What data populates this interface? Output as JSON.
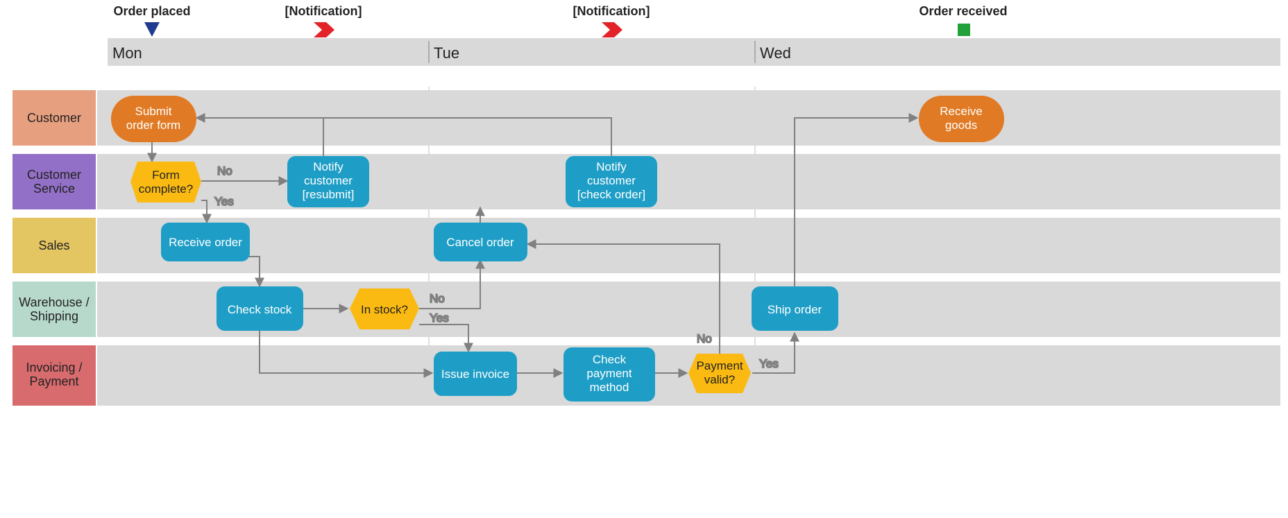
{
  "timeline": {
    "days": [
      "Mon",
      "Tue",
      "Wed"
    ],
    "markers": {
      "order_placed": {
        "label": "Order placed"
      },
      "notification_1": {
        "label": "[Notification]"
      },
      "notification_2": {
        "label": "[Notification]"
      },
      "order_received": {
        "label": "Order received"
      }
    }
  },
  "lanes": {
    "customer": {
      "label": "Customer"
    },
    "customer_service": {
      "label": "Customer\nService"
    },
    "sales": {
      "label": "Sales"
    },
    "warehouse": {
      "label": "Warehouse /\nShipping"
    },
    "invoicing": {
      "label": "Invoicing /\nPayment"
    }
  },
  "nodes": {
    "submit_order": {
      "label": "Submit\norder form"
    },
    "receive_goods": {
      "label": "Receive\ngoods"
    },
    "form_complete": {
      "label": "Form\ncomplete?"
    },
    "notify_resubmit": {
      "label": "Notify\ncustomer\n[resubmit]"
    },
    "notify_check": {
      "label": "Notify\ncustomer\n[check order]"
    },
    "receive_order": {
      "label": "Receive order"
    },
    "cancel_order": {
      "label": "Cancel order"
    },
    "check_stock": {
      "label": "Check stock"
    },
    "in_stock": {
      "label": "In stock?"
    },
    "ship_order": {
      "label": "Ship order"
    },
    "issue_invoice": {
      "label": "Issue invoice"
    },
    "check_payment": {
      "label": "Check\npayment\nmethod"
    },
    "payment_valid": {
      "label": "Payment\nvalid?"
    }
  },
  "edge_labels": {
    "no": "No",
    "yes": "Yes"
  },
  "colors": {
    "blue_node": "#1E9EC6",
    "orange_node": "#E17A24",
    "yellow_node": "#FBBA12",
    "lane_bg": "#D9D9D9",
    "grey_line": "#808080",
    "timeline_bg": "#D9D9D9",
    "lane_customer": "#E7A07F",
    "lane_service": "#9370C7",
    "lane_sales": "#E3C562",
    "lane_warehouse": "#B7D9CC",
    "lane_invoicing": "#D86B6E",
    "marker_blue": "#1F3C90",
    "marker_red": "#E3232A",
    "marker_green": "#22A13A"
  },
  "chart_data": {
    "type": "swimlane_flowchart",
    "timeline": {
      "days": [
        "Mon",
        "Tue",
        "Wed"
      ],
      "milestones": [
        "Order placed",
        "[Notification]",
        "[Notification]",
        "Order received"
      ]
    },
    "lanes": [
      "Customer",
      "Customer Service",
      "Sales",
      "Warehouse / Shipping",
      "Invoicing / Payment"
    ],
    "nodes": [
      {
        "id": "submit_order",
        "lane": "Customer",
        "day": "Mon",
        "kind": "terminator",
        "label": "Submit order form"
      },
      {
        "id": "receive_goods",
        "lane": "Customer",
        "day": "Wed",
        "kind": "terminator",
        "label": "Receive goods"
      },
      {
        "id": "form_complete",
        "lane": "Customer Service",
        "day": "Mon",
        "kind": "decision",
        "label": "Form complete?"
      },
      {
        "id": "notify_resubmit",
        "lane": "Customer Service",
        "day": "Mon",
        "kind": "process",
        "label": "Notify customer [resubmit]"
      },
      {
        "id": "notify_check",
        "lane": "Customer Service",
        "day": "Tue",
        "kind": "process",
        "label": "Notify customer [check order]"
      },
      {
        "id": "receive_order",
        "lane": "Sales",
        "day": "Mon",
        "kind": "process",
        "label": "Receive order"
      },
      {
        "id": "cancel_order",
        "lane": "Sales",
        "day": "Tue",
        "kind": "process",
        "label": "Cancel order"
      },
      {
        "id": "check_stock",
        "lane": "Warehouse / Shipping",
        "day": "Mon",
        "kind": "process",
        "label": "Check stock"
      },
      {
        "id": "in_stock",
        "lane": "Warehouse / Shipping",
        "day": "Mon",
        "kind": "decision",
        "label": "In stock?"
      },
      {
        "id": "ship_order",
        "lane": "Warehouse / Shipping",
        "day": "Wed",
        "kind": "process",
        "label": "Ship order"
      },
      {
        "id": "issue_invoice",
        "lane": "Invoicing / Payment",
        "day": "Tue",
        "kind": "process",
        "label": "Issue invoice"
      },
      {
        "id": "check_payment",
        "lane": "Invoicing / Payment",
        "day": "Tue",
        "kind": "process",
        "label": "Check payment method"
      },
      {
        "id": "payment_valid",
        "lane": "Invoicing / Payment",
        "day": "Tue",
        "kind": "decision",
        "label": "Payment valid?"
      }
    ],
    "edges": [
      {
        "from": "submit_order",
        "to": "form_complete"
      },
      {
        "from": "form_complete",
        "to": "notify_resubmit",
        "label": "No"
      },
      {
        "from": "form_complete",
        "to": "receive_order",
        "label": "Yes"
      },
      {
        "from": "notify_resubmit",
        "to": "submit_order"
      },
      {
        "from": "receive_order",
        "to": "check_stock"
      },
      {
        "from": "check_stock",
        "to": "in_stock"
      },
      {
        "from": "in_stock",
        "to": "cancel_order",
        "label": "No"
      },
      {
        "from": "in_stock",
        "to": "issue_invoice",
        "label": "Yes"
      },
      {
        "from": "cancel_order",
        "to": "notify_check"
      },
      {
        "from": "notify_check",
        "to": "submit_order"
      },
      {
        "from": "check_stock",
        "to": "issue_invoice"
      },
      {
        "from": "issue_invoice",
        "to": "check_payment"
      },
      {
        "from": "check_payment",
        "to": "payment_valid"
      },
      {
        "from": "payment_valid",
        "to": "cancel_order",
        "label": "No"
      },
      {
        "from": "payment_valid",
        "to": "ship_order",
        "label": "Yes"
      },
      {
        "from": "ship_order",
        "to": "receive_goods"
      }
    ]
  }
}
